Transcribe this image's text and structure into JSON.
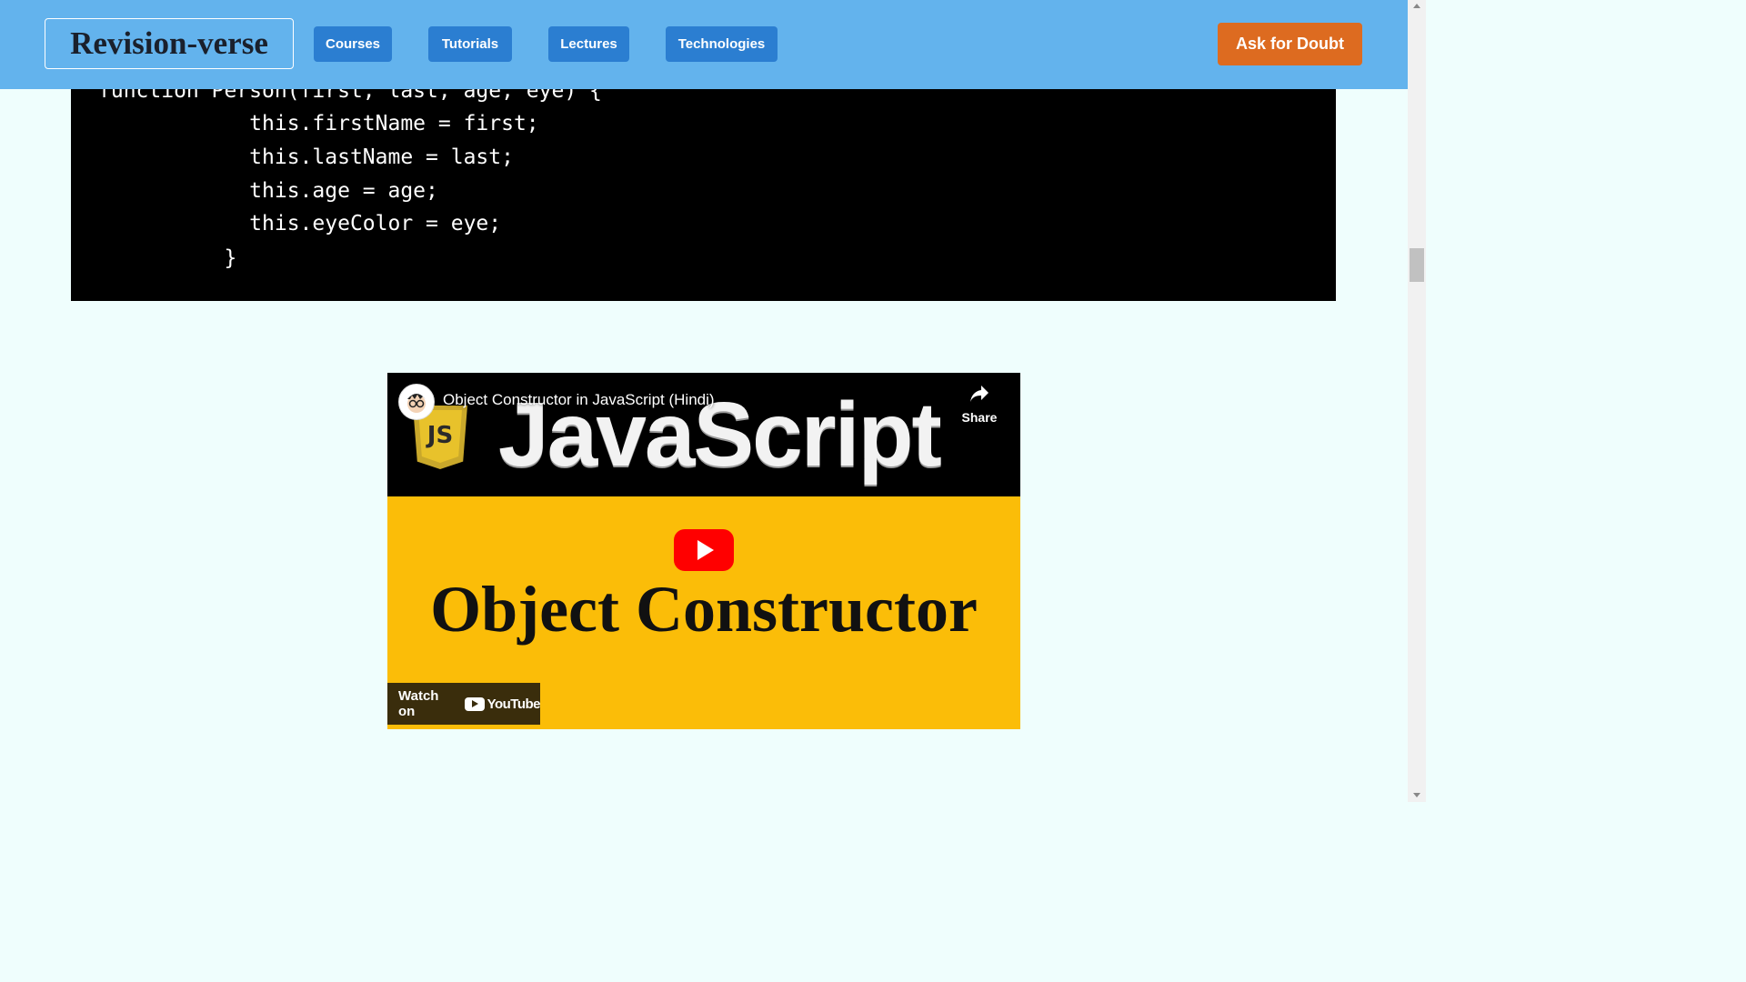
{
  "header": {
    "brand": "Revision-verse",
    "nav": [
      "Courses",
      "Tutorials",
      "Lectures",
      "Technologies"
    ],
    "ask_button": "Ask for Doubt"
  },
  "code": {
    "lines": [
      "function Person(first, last, age, eye) {",
      "            this.firstName = first;",
      "            this.lastName = last;",
      "            this.age = age;",
      "            this.eyeColor = eye;",
      "          }"
    ]
  },
  "video": {
    "title": "Object Constructor in JavaScript (Hindi)",
    "share_label": "Share",
    "banner_text": "JavaScript",
    "js_logo_text": "JS",
    "thumbnail_text": "Object Constructor",
    "watch_label": "Watch on",
    "youtube_label": "YouTube",
    "icons": {
      "channel": "channel-avatar-icon",
      "share": "share-arrow-icon",
      "play": "play-button-icon",
      "youtube": "youtube-logo-icon"
    }
  },
  "colors": {
    "header_bg": "#63b3ed",
    "nav_button": "#2b7ed1",
    "ask_button": "#dd6b20",
    "page_bg": "#effefd",
    "thumbnail_bg": "#fbbd08"
  }
}
